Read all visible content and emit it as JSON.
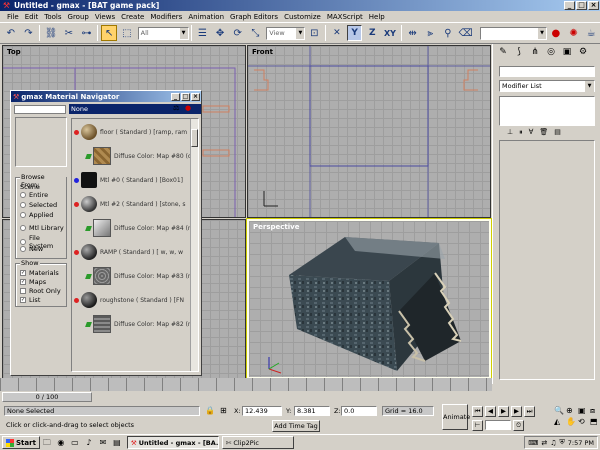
{
  "window": {
    "title": "Untitled - gmax - [BAT game pack]",
    "controls": {
      "minimize": "_",
      "maximize": "□",
      "close": "×"
    }
  },
  "menu": [
    "File",
    "Edit",
    "Tools",
    "Group",
    "Views",
    "Create",
    "Modifiers",
    "Animation",
    "Graph Editors",
    "Customize",
    "MAXScript",
    "Help"
  ],
  "toolbar": {
    "selection_filter": "All",
    "reference_coord": "View",
    "icons": [
      "undo-icon",
      "redo-icon",
      "link-icon",
      "unlink-icon",
      "bind-icon",
      "select-icon",
      "region-select-icon",
      "move-icon",
      "rotate-icon",
      "scale-icon",
      "mirror-icon",
      "align-icon"
    ]
  },
  "viewports": {
    "top": {
      "label": "Top"
    },
    "front": {
      "label": "Front"
    },
    "left": {
      "label": ""
    },
    "perspective": {
      "label": "Perspective"
    }
  },
  "command_panel": {
    "modifier_list": "Modifier List"
  },
  "material_navigator": {
    "title": "gmax Material Navigator",
    "selected": "None",
    "browse_from": {
      "label": "Browse From:",
      "scene_label": "Scene",
      "options": [
        "Entire",
        "Selected",
        "Applied",
        "Mtl Library",
        "File System",
        "New"
      ]
    },
    "show": {
      "label": "Show",
      "options": [
        "Materials",
        "Maps",
        "Root Only",
        "List"
      ]
    },
    "items": [
      {
        "label": "floor  ( Standard )  [ramp, ram",
        "kind": "material"
      },
      {
        "label": "Diffuse Color: Map #80 (c",
        "kind": "map"
      },
      {
        "label": "Mtl #0  ( Standard )  [Box01]",
        "kind": "material"
      },
      {
        "label": "Mtl #2  ( Standard )  [stone, s",
        "kind": "material"
      },
      {
        "label": "Diffuse Color: Map #84 (n",
        "kind": "map"
      },
      {
        "label": "RAMP  ( Standard )  [ w, w, w",
        "kind": "material"
      },
      {
        "label": "Diffuse Color: Map #83 (n",
        "kind": "map"
      },
      {
        "label": "roughstone  ( Standard )  [FN",
        "kind": "material"
      },
      {
        "label": "Diffuse Color: Map #82 (n",
        "kind": "map"
      }
    ]
  },
  "timeline": {
    "frame": "0 / 100"
  },
  "status": {
    "selection": "None Selected",
    "prompt": "Click or click-and-drag to select objects",
    "x_label": "X:",
    "x": "12.439",
    "y_label": "Y:",
    "y": "8.381",
    "z_label": "Z:",
    "z": "0.0",
    "grid": "Grid = 16.0",
    "add_time_tag": "Add Time Tag",
    "animate": "Animate"
  },
  "taskbar": {
    "start": "Start",
    "tasks": [
      "Untitled - gmax - [BA...",
      "Clip2Pic"
    ],
    "clock": "7:57 PM"
  },
  "colors": {
    "title_gradient_start": "#0a246a",
    "title_gradient_end": "#a6caf0",
    "viewport_bg": "#aeaeae",
    "active_tool": "#ffd36b"
  }
}
